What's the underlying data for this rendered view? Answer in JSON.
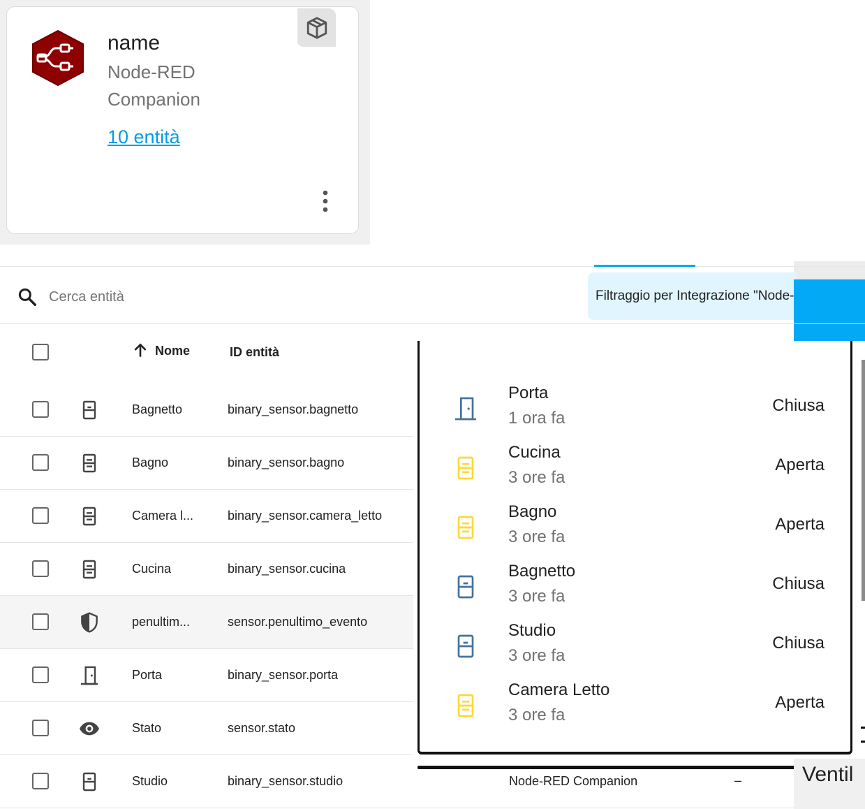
{
  "card": {
    "name": "name",
    "subtitle_line1": "Node-RED",
    "subtitle_line2": "Companion",
    "entities_link": "10 entità",
    "logo_color": "#8f0000"
  },
  "table": {
    "search_placeholder": "Cerca entità",
    "filter_text": "Filtraggio per Integrazione \"Node-RED Companion\"",
    "columns": {
      "name": "Nome",
      "entity_id": "ID entità"
    },
    "rows": [
      {
        "icon": "door-sensor-closed-icon",
        "name": "Bagnetto",
        "entity_id": "binary_sensor.bagnetto"
      },
      {
        "icon": "door-sensor-open-icon",
        "name": "Bagno",
        "entity_id": "binary_sensor.bagno"
      },
      {
        "icon": "door-sensor-open-icon",
        "name": "Camera l...",
        "entity_id": "binary_sensor.camera_letto"
      },
      {
        "icon": "door-sensor-open-icon",
        "name": "Cucina",
        "entity_id": "binary_sensor.cucina"
      },
      {
        "icon": "shield-half-icon",
        "name": "penultim...",
        "entity_id": "sensor.penultimo_evento"
      },
      {
        "icon": "door-icon",
        "name": "Porta",
        "entity_id": "binary_sensor.porta"
      },
      {
        "icon": "eye-icon",
        "name": "Stato",
        "entity_id": "sensor.stato"
      },
      {
        "icon": "door-sensor-closed-icon",
        "name": "Studio",
        "entity_id": "binary_sensor.studio",
        "integration": "Node-RED Companion",
        "area": "–"
      }
    ]
  },
  "overlay": {
    "entities": [
      {
        "icon": "door-icon",
        "name": "Porta",
        "time": "1 ora fa",
        "state": "Chiusa",
        "color": "#44739e"
      },
      {
        "icon": "door-sensor-open-icon",
        "name": "Cucina",
        "time": "3 ore fa",
        "state": "Aperta",
        "color": "#fdd835"
      },
      {
        "icon": "door-sensor-open-icon",
        "name": "Bagno",
        "time": "3 ore fa",
        "state": "Aperta",
        "color": "#fdd835"
      },
      {
        "icon": "door-sensor-closed-icon",
        "name": "Bagnetto",
        "time": "3 ore fa",
        "state": "Chiusa",
        "color": "#44739e"
      },
      {
        "icon": "door-sensor-closed-icon",
        "name": "Studio",
        "time": "3 ore fa",
        "state": "Chiusa",
        "color": "#44739e"
      },
      {
        "icon": "door-sensor-open-icon",
        "name": "Camera Letto",
        "time": "3 ore fa",
        "state": "Aperta",
        "color": "#fdd835"
      }
    ]
  },
  "partial": {
    "ventilation_text": "Ventil"
  },
  "colors": {
    "accent": "#03a9f4",
    "chip_bg": "#e1f5fe",
    "link": "#039be5"
  }
}
